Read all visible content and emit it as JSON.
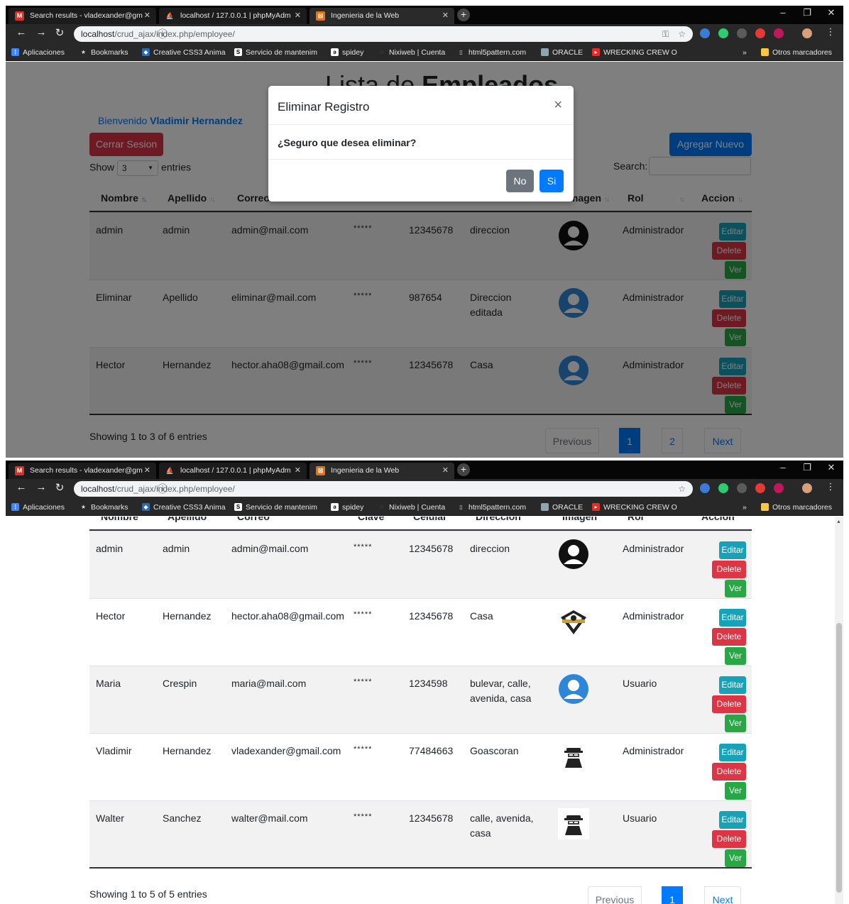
{
  "browser": {
    "tabs": [
      {
        "title": "Search results - vladexander@gm",
        "icon": "gmail-icon"
      },
      {
        "title": "localhost / 127.0.0.1 | phpMyAdm",
        "icon": "phpmyadmin-icon"
      },
      {
        "title": "Ingenieria de la Web",
        "icon": "tab-site-icon"
      }
    ],
    "address": {
      "host": "localhost",
      "path": "/crud_ajax/index.php/employee/"
    },
    "bookmarks": [
      "Aplicaciones",
      "Bookmarks",
      "Creative CSS3 Anima",
      "Servicio de mantenim",
      "spidey",
      "Nixiweb | Cuenta",
      "html5pattern.com",
      "ORACLE",
      "WRECKING CREW O",
      "Otros marcadores"
    ]
  },
  "screen1": {
    "heading_light": "Lista de",
    "heading_bold": "Empleados",
    "welcome_prefix": "Bienvenido",
    "welcome_user": "Vladimir Hernandez",
    "logout_label": "Cerrar Sesion",
    "add_label": "Agregar Nuevo",
    "show_label": "Show",
    "show_value": "3",
    "entries_label": "entries",
    "search_label": "Search:",
    "columns": [
      "Nombre",
      "Apellido",
      "Correo",
      "Imagen",
      "Rol",
      "Accion"
    ],
    "rows": [
      {
        "nombre": "admin",
        "apellido": "admin",
        "correo": "admin@mail.com",
        "clave": "*****",
        "celular": "12345678",
        "direccion": "direccion",
        "rol": "Administrador"
      },
      {
        "nombre": "Eliminar",
        "apellido": "Apellido",
        "correo": "eliminar@mail.com",
        "clave": "*****",
        "celular": "987654",
        "direccion": "Direccion editada",
        "rol": "Administrador"
      },
      {
        "nombre": "Hector",
        "apellido": "Hernandez",
        "correo": "hector.aha08@gmail.com",
        "clave": "*****",
        "celular": "12345678",
        "direccion": "Casa",
        "rol": "Administrador"
      }
    ],
    "info": "Showing 1 to 3 of 6 entries",
    "pagination": {
      "previous": "Previous",
      "pages": [
        "1",
        "2"
      ],
      "next": "Next"
    },
    "modal": {
      "title": "Eliminar Registro",
      "close": "×",
      "body": "¿Seguro que desea eliminar?",
      "no": "No",
      "yes": "Si"
    }
  },
  "screen2": {
    "columns": [
      "Nombre",
      "Apellido",
      "Correo",
      "Clave",
      "Celular",
      "Direccion",
      "Imagen",
      "Rol",
      "Accion"
    ],
    "rows": [
      {
        "nombre": "admin",
        "apellido": "admin",
        "correo": "admin@mail.com",
        "clave": "*****",
        "celular": "12345678",
        "direccion": "direccion",
        "rol": "Administrador"
      },
      {
        "nombre": "Hector",
        "apellido": "Hernandez",
        "correo": "hector.aha08@gmail.com",
        "clave": "*****",
        "celular": "12345678",
        "direccion": "Casa",
        "rol": "Administrador"
      },
      {
        "nombre": "Maria",
        "apellido": "Crespin",
        "correo": "maria@mail.com",
        "clave": "*****",
        "celular": "1234598",
        "direccion": "bulevar, calle, avenida, casa",
        "rol": "Usuario"
      },
      {
        "nombre": "Vladimir",
        "apellido": "Hernandez",
        "correo": "vladexander@gmail.com",
        "clave": "*****",
        "celular": "77484663",
        "direccion": "Goascoran",
        "rol": "Administrador"
      },
      {
        "nombre": "Walter",
        "apellido": "Sanchez",
        "correo": "walter@mail.com",
        "clave": "*****",
        "celular": "12345678",
        "direccion": "calle, avenida, casa",
        "rol": "Usuario"
      }
    ],
    "info": "Showing 1 to 5 of 5 entries",
    "pagination": {
      "previous": "Previous",
      "pages": [
        "1"
      ],
      "next": "Next"
    }
  },
  "actions": {
    "edit": "Editar",
    "delete": "Delete",
    "view": "Ver"
  },
  "colors": {
    "primary": "#007bff",
    "danger": "#dc3545",
    "info": "#17a2b8",
    "success": "#28a745",
    "secondary": "#6c757d"
  }
}
